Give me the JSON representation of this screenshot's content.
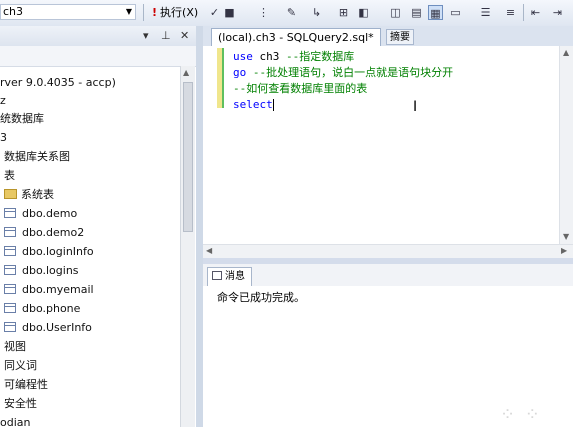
{
  "toolbar": {
    "database": "ch3",
    "execute_label": "执行(X)",
    "icons": [
      "check-icon",
      "parse-icon",
      "debug-icon",
      "query-design-icon",
      "show-plan-icon",
      "options-icon",
      "results-text-icon",
      "results-grid-icon",
      "results-file-icon",
      "comment-icon",
      "uncomment-icon",
      "indent-icon",
      "outdent-icon"
    ]
  },
  "explorer": {
    "header_pin": "▾",
    "header_pushpin": "⊥",
    "header_close": "✕",
    "tree": [
      {
        "label": "rver 9.0.4035 - accp)",
        "kind": "server"
      },
      {
        "label": "z",
        "kind": "text"
      },
      {
        "label": "统数据库",
        "kind": "text"
      },
      {
        "label": "3",
        "kind": "text"
      },
      {
        "label": "数据库关系图",
        "kind": "text"
      },
      {
        "label": "表",
        "kind": "text"
      },
      {
        "label": "系统表",
        "kind": "folder"
      },
      {
        "label": "dbo.demo",
        "kind": "table"
      },
      {
        "label": "dbo.demo2",
        "kind": "table"
      },
      {
        "label": "dbo.loginInfo",
        "kind": "table"
      },
      {
        "label": "dbo.logins",
        "kind": "table"
      },
      {
        "label": "dbo.myemail",
        "kind": "table"
      },
      {
        "label": "dbo.phone",
        "kind": "table"
      },
      {
        "label": "dbo.UserInfo",
        "kind": "table"
      },
      {
        "label": "视图",
        "kind": "text"
      },
      {
        "label": "同义词",
        "kind": "text"
      },
      {
        "label": "可编程性",
        "kind": "text"
      },
      {
        "label": "安全性",
        "kind": "text"
      },
      {
        "label": "odian",
        "kind": "text"
      }
    ]
  },
  "tabs": {
    "active": "(local).ch3 - SQLQuery2.sql*",
    "summary": "摘要"
  },
  "editor": {
    "lines": [
      {
        "kw": "use",
        "plain": " ch3 ",
        "comment": "--指定数据库"
      },
      {
        "kw": "go",
        "plain": " ",
        "comment": "--批处理语句，说白一点就是语句块分开"
      },
      {
        "kw": "",
        "plain": "",
        "comment": "--如何查看数据库里面的表"
      },
      {
        "kw": "select",
        "plain": "",
        "comment": ""
      }
    ]
  },
  "results": {
    "tab_label": "消息",
    "message": "命令已成功完成。"
  },
  "colors": {
    "keyword": "#0000ff",
    "comment": "#008000",
    "tab_strip": "#dbe3ef"
  }
}
